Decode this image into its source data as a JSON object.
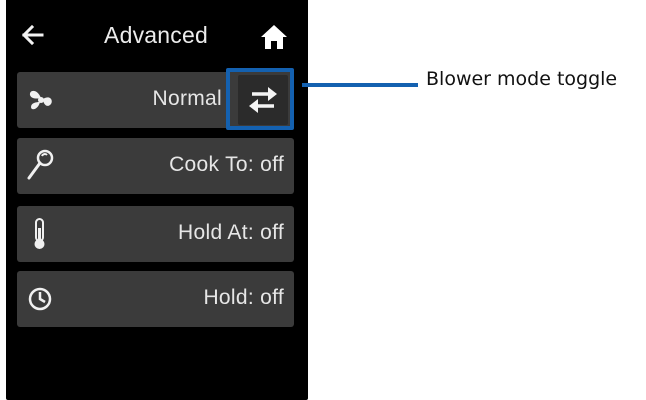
{
  "header": {
    "title": "Advanced",
    "back_icon": "arrow-left-icon",
    "home_icon": "home-icon"
  },
  "rows": [
    {
      "icon": "fan-icon",
      "label": "Normal",
      "action_icon": "swap-arrows-icon"
    },
    {
      "icon": "probe-icon",
      "label": "Cook To: off"
    },
    {
      "icon": "thermometer-icon",
      "label": "Hold At: off"
    },
    {
      "icon": "clock-icon",
      "label": "Hold: off"
    }
  ],
  "annotation": {
    "label": "Blower mode toggle",
    "color": "#1461b0"
  },
  "colors": {
    "screen_bg": "#000000",
    "row_bg": "#3b3b3b",
    "text": "#e6e6e6"
  }
}
